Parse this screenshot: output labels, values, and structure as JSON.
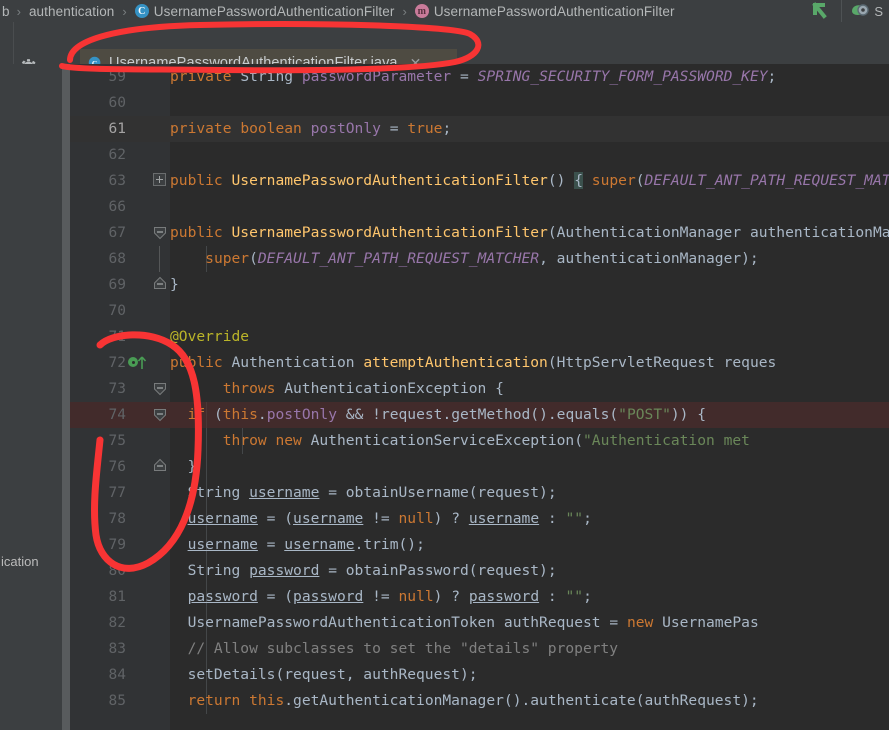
{
  "breadcrumb": {
    "items": [
      {
        "label": "authentication",
        "icon": "none"
      },
      {
        "label": "UsernamePasswordAuthenticationFilter",
        "icon": "class-icon",
        "glyph": "C"
      },
      {
        "label": "UsernamePasswordAuthenticationFilter",
        "icon": "method-icon",
        "glyph": "m"
      }
    ],
    "separator": "›",
    "truncated_prefix": "b"
  },
  "toolbar": {
    "gear_icon": "gear-icon",
    "minimize_icon": "minus-icon",
    "back_arrow_icon": "back-arrow-icon",
    "run_config_icon": "run-config-icon",
    "run_config_label": "S"
  },
  "tab": {
    "label": "UsernamePasswordAuthenticationFilter.java",
    "icon": "java-class-icon",
    "close_icon": "close-icon"
  },
  "tool_window": {
    "clipped_label": "ication"
  },
  "editor": {
    "first_visible_line": 59,
    "caret_line": 61,
    "breakpoint_line": 74,
    "override_marker_line": 72,
    "colors": {
      "background": "#2b2b2b",
      "gutter": "#313335",
      "caret_row": "#323232",
      "breakpoint_row": "#422b2b",
      "keyword": "#cc7832",
      "string": "#6a8759",
      "field": "#9876aa",
      "method": "#ffc66d",
      "comment": "#808080",
      "text": "#a9b7c6",
      "breakpoint_dot": "#c75450",
      "override_marker": "#499c54",
      "annotation_red": "#f83434"
    },
    "lines": [
      {
        "n": 59,
        "text": "    private String passwordParameter = SPRING_SECURITY_FORM_PASSWORD_KEY;"
      },
      {
        "n": 60,
        "text": ""
      },
      {
        "n": 61,
        "text": "    private boolean postOnly = true;"
      },
      {
        "n": 62,
        "text": ""
      },
      {
        "n": 63,
        "text": "    public UsernamePasswordAuthenticationFilter() { super(DEFAULT_ANT_PATH_REQUEST_MATCHER); }"
      },
      {
        "n": 66,
        "text": ""
      },
      {
        "n": 67,
        "text": "    public UsernamePasswordAuthenticationFilter(AuthenticationManager authenticationManager) {"
      },
      {
        "n": 68,
        "text": "        super(DEFAULT_ANT_PATH_REQUEST_MATCHER, authenticationManager);"
      },
      {
        "n": 69,
        "text": "    }"
      },
      {
        "n": 70,
        "text": ""
      },
      {
        "n": 71,
        "text": "    @Override"
      },
      {
        "n": 72,
        "text": "    public Authentication attemptAuthentication(HttpServletRequest request, HttpServletResponse"
      },
      {
        "n": 73,
        "text": "            throws AuthenticationException {"
      },
      {
        "n": 74,
        "text": "        if (this.postOnly && !request.getMethod().equals(\"POST\")) {"
      },
      {
        "n": 75,
        "text": "            throw new AuthenticationServiceException(\"Authentication method"
      },
      {
        "n": 76,
        "text": "        }"
      },
      {
        "n": 77,
        "text": "        String username = obtainUsername(request);"
      },
      {
        "n": 78,
        "text": "        username = (username != null) ? username : \"\";"
      },
      {
        "n": 79,
        "text": "        username = username.trim();"
      },
      {
        "n": 80,
        "text": "        String password = obtainPassword(request);"
      },
      {
        "n": 81,
        "text": "        password = (password != null) ? password : \"\";"
      },
      {
        "n": 82,
        "text": "        UsernamePasswordAuthenticationToken authRequest = new UsernamePas"
      },
      {
        "n": 83,
        "text": "        // Allow subclasses to set the \"details\" property"
      },
      {
        "n": 84,
        "text": "        setDetails(request, authRequest);"
      },
      {
        "n": 85,
        "text": "        return this.getAuthenticationManager().authenticate(authRequest);"
      }
    ]
  }
}
